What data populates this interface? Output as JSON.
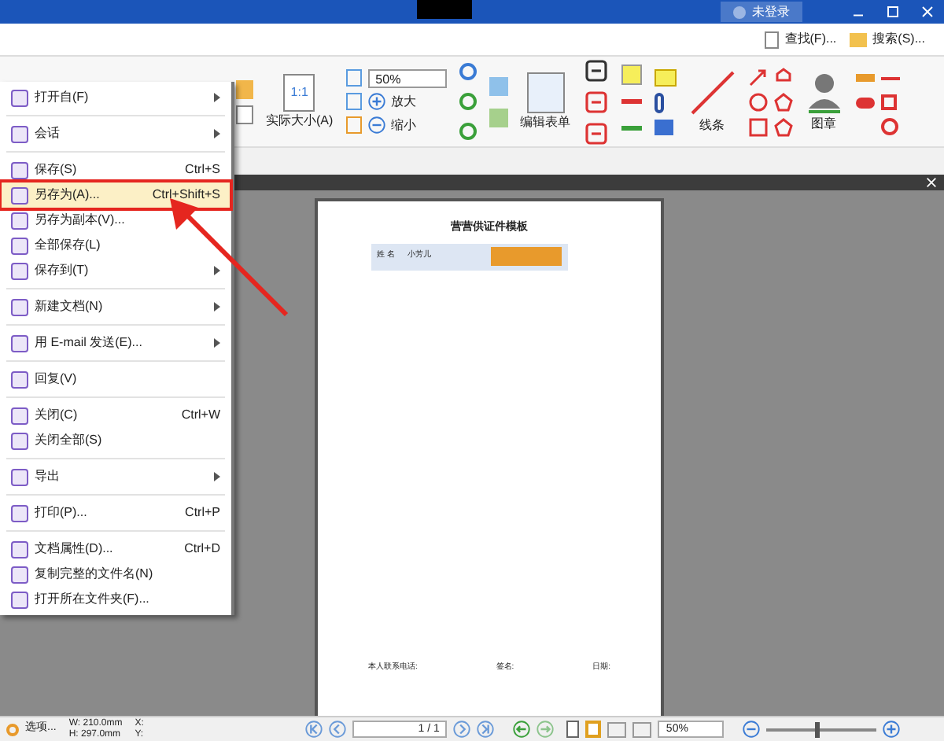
{
  "title_bar": {
    "account": "未登录"
  },
  "quick_tools": [
    {
      "label": "查找(F)..."
    },
    {
      "label": "搜索(S)..."
    }
  ],
  "ribbon": {
    "zoom_value": "50%",
    "zoom_in": "放大",
    "zoom_out": "缩小",
    "actual_size": "实际大小(A)",
    "actual_size_icon": "1:1",
    "edit_form": "编辑表单",
    "line": "线条",
    "stamp": "图章"
  },
  "file_menu": [
    {
      "kind": "item",
      "label": "打开自(F)",
      "submenu": true,
      "selected": false
    },
    {
      "kind": "separator"
    },
    {
      "kind": "item",
      "label": "会话",
      "submenu": true,
      "selected": false
    },
    {
      "kind": "separator"
    },
    {
      "kind": "item",
      "label": "保存(S)",
      "shortcut": "Ctrl+S",
      "selected": false
    },
    {
      "kind": "item",
      "label": "另存为(A)...",
      "shortcut": "Ctrl+Shift+S",
      "selected": true
    },
    {
      "kind": "item",
      "label": "另存为副本(V)...",
      "selected": false
    },
    {
      "kind": "item",
      "label": "全部保存(L)",
      "selected": false
    },
    {
      "kind": "item",
      "label": "保存到(T)",
      "submenu": true,
      "selected": false
    },
    {
      "kind": "separator"
    },
    {
      "kind": "item",
      "label": "新建文档(N)",
      "submenu": true,
      "selected": false
    },
    {
      "kind": "separator"
    },
    {
      "kind": "item",
      "label": "用 E-mail 发送(E)...",
      "submenu": true,
      "selected": false
    },
    {
      "kind": "separator"
    },
    {
      "kind": "item",
      "label": "回复(V)",
      "selected": false
    },
    {
      "kind": "separator"
    },
    {
      "kind": "item",
      "label": "关闭(C)",
      "shortcut": "Ctrl+W",
      "selected": false
    },
    {
      "kind": "item",
      "label": "关闭全部(S)",
      "selected": false
    },
    {
      "kind": "separator"
    },
    {
      "kind": "item",
      "label": "导出",
      "submenu": true,
      "selected": false
    },
    {
      "kind": "separator"
    },
    {
      "kind": "item",
      "label": "打印(P)...",
      "shortcut": "Ctrl+P",
      "selected": false
    },
    {
      "kind": "separator"
    },
    {
      "kind": "item",
      "label": "文档属性(D)...",
      "shortcut": "Ctrl+D",
      "selected": false
    },
    {
      "kind": "item",
      "label": "复制完整的文件名(N)",
      "selected": false
    },
    {
      "kind": "item",
      "label": "打开所在文件夹(F)...",
      "selected": false
    }
  ],
  "document": {
    "title": "营营供证件模板",
    "card_label": "姓 名",
    "card_value": "小芳儿",
    "footer": [
      "本人联系电话:",
      "签名:",
      "日期:"
    ]
  },
  "status_bar": {
    "options": "选项...",
    "width": "W: 210.0mm",
    "height": "H: 297.0mm",
    "x": "X:",
    "y": "Y:",
    "page": "1 / 1",
    "zoom": "50%",
    "zoom_slider": {
      "level": 0.45
    }
  }
}
